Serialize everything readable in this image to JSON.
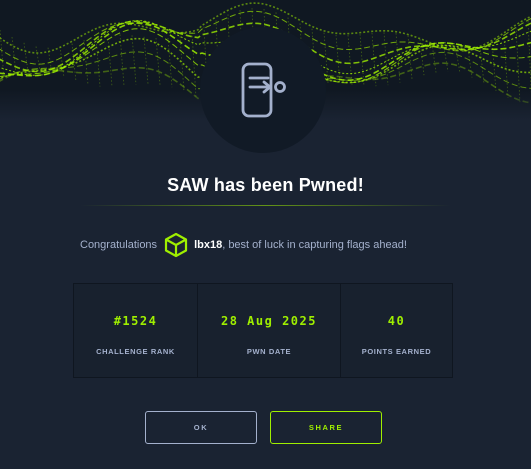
{
  "modal": {
    "title": "SAW has been Pwned!",
    "congrats_prefix": "Congratulations",
    "username": "lbx18",
    "congrats_suffix": ", best of luck in capturing flags ahead!"
  },
  "stats": [
    {
      "value": "#1524",
      "label": "CHALLENGE RANK"
    },
    {
      "value": "28 Aug 2025",
      "label": "PWN DATE"
    },
    {
      "value": "40",
      "label": "POINTS EARNED"
    }
  ],
  "buttons": {
    "ok_label": "OK",
    "share_label": "SHARE"
  },
  "icons": {
    "hero": "exit-door-icon",
    "user": "cube-icon"
  },
  "colors": {
    "accent": "#9fef00",
    "background": "#1a2332",
    "muted_text": "#a4b1cd"
  }
}
